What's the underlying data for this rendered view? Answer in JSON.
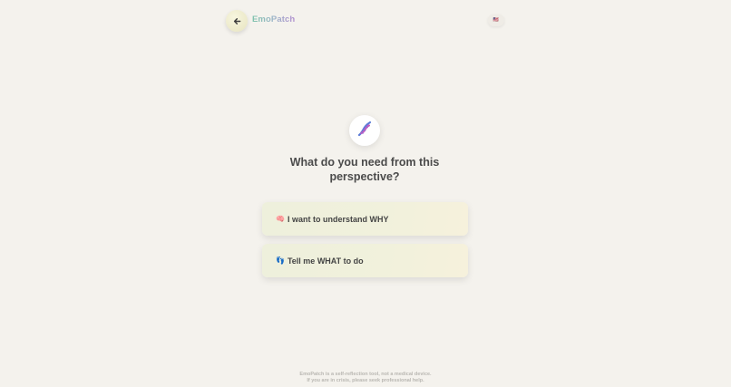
{
  "header": {
    "back_icon": "arrow-left-icon",
    "brand": "EmoPatch",
    "language_flag": "🇺🇸",
    "brand_gradient": [
      "#7fc3ac",
      "#b18fcf"
    ]
  },
  "main": {
    "hero_icon": "dna-icon",
    "question": "What do you need from this perspective?",
    "options": [
      {
        "emoji": "🧠",
        "label": "I want to understand WHY"
      },
      {
        "emoji": "👣",
        "label": "Tell me WHAT to do"
      }
    ]
  },
  "footer": {
    "line1": "EmoPatch is a self-reflection tool, not a medical device.",
    "line2": "If you are in crisis, please seek professional help."
  },
  "colors": {
    "background": "#f4f2ed",
    "card": "#eff0dc",
    "text": "#444444"
  }
}
